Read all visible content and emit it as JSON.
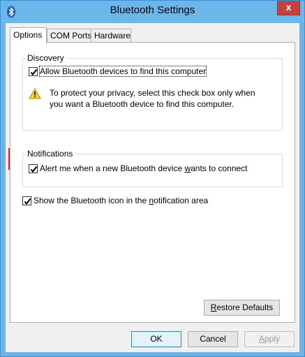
{
  "window": {
    "title": "Bluetooth Settings",
    "close_glyph": "x"
  },
  "tabs": [
    {
      "label": "Options",
      "active": true
    },
    {
      "label": "COM Ports",
      "active": false
    },
    {
      "label": "Hardware",
      "active": false
    }
  ],
  "discovery": {
    "group_label": "Discovery",
    "allow_label": "Allow Bluetooth devices to find this computer",
    "allow_checked": true,
    "warning_line1": "To protect your privacy, select this check box only when",
    "warning_line2": "you want a Bluetooth device to find this computer."
  },
  "notifications": {
    "group_label": "Notifications",
    "alert_label_pre": "Alert me when a new Bluetooth device ",
    "alert_label_u": "w",
    "alert_label_post": "ants to connect",
    "alert_checked": true
  },
  "show_icon": {
    "label_pre": "Show the Bluetooth icon in the ",
    "label_u": "n",
    "label_post": "otification area",
    "checked": true
  },
  "buttons": {
    "restore_u": "R",
    "restore_rest": "estore Defaults",
    "ok": "OK",
    "cancel": "Cancel",
    "apply": "Apply",
    "apply_u": "A",
    "apply_rest": "pply"
  },
  "colors": {
    "title_bar": "#6cb6ea",
    "close_button": "#c7413a",
    "highlight_border": "#e0202e",
    "warning_yellow": "#f7d230"
  },
  "icons": [
    "bluetooth-icon",
    "close-icon",
    "warning-icon",
    "checkmark-icon"
  ]
}
